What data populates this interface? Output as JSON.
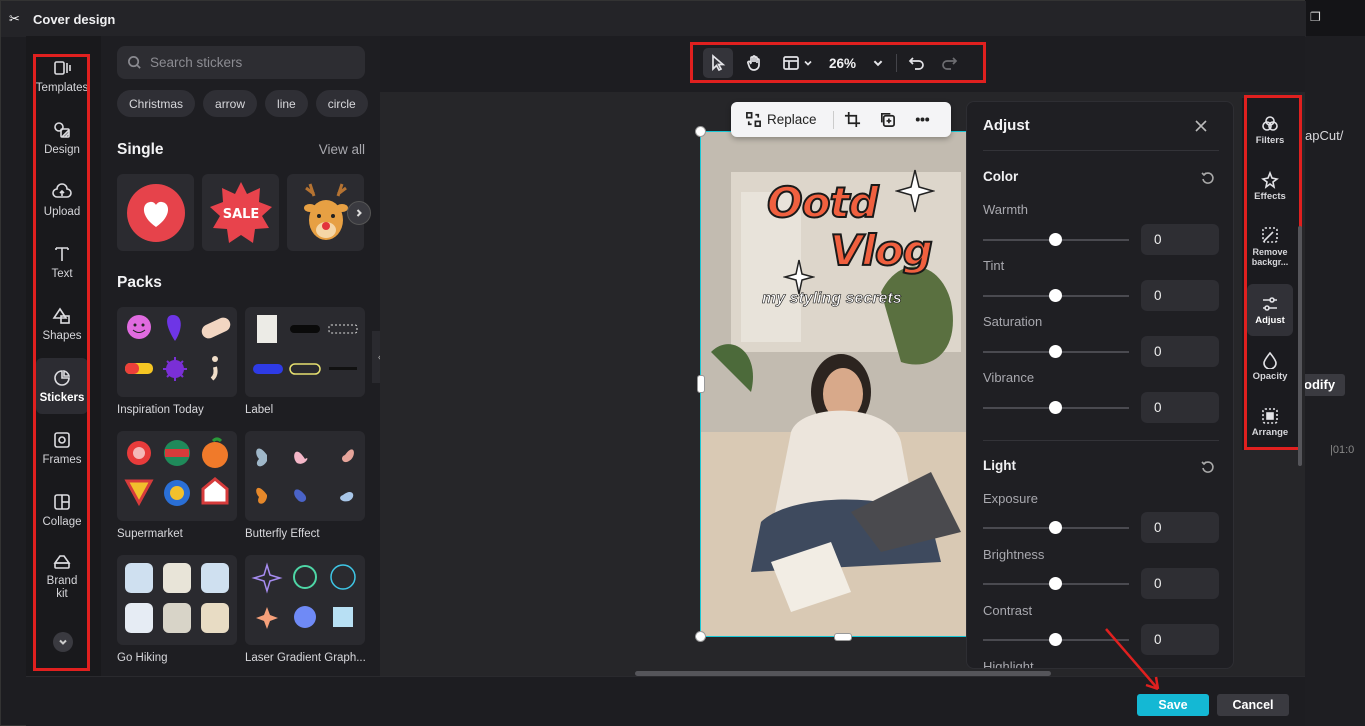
{
  "window": {
    "title": "Cover design"
  },
  "background_app": {
    "path_fragment": "apCut/",
    "modify_label": "odify",
    "time_label": "|01:0"
  },
  "nav": {
    "items": [
      {
        "label": "Templates"
      },
      {
        "label": "Design"
      },
      {
        "label": "Upload"
      },
      {
        "label": "Text"
      },
      {
        "label": "Shapes"
      },
      {
        "label": "Stickers",
        "active": true
      },
      {
        "label": "Frames"
      },
      {
        "label": "Collage"
      },
      {
        "label": "Brand kit"
      }
    ]
  },
  "stickers": {
    "search_placeholder": "Search stickers",
    "chips": [
      "Christmas",
      "arrow",
      "line",
      "circle"
    ],
    "single_title": "Single",
    "view_all": "View all",
    "single_items": [
      {
        "icon": "heart-sticker"
      },
      {
        "icon": "sale-sticker",
        "text": "SALE"
      },
      {
        "icon": "reindeer-sticker"
      }
    ],
    "packs_title": "Packs",
    "packs": [
      {
        "name": "Inspiration Today"
      },
      {
        "name": "Label"
      },
      {
        "name": "Supermarket"
      },
      {
        "name": "Butterfly Effect"
      },
      {
        "name": "Go Hiking"
      },
      {
        "name": "Laser Gradient Graph..."
      }
    ]
  },
  "toolbar": {
    "zoom": "26%"
  },
  "image_toolbar": {
    "replace_label": "Replace"
  },
  "cover_text": {
    "line1": "Ootd",
    "line2": "Vlog",
    "subtitle": "my styling secrets"
  },
  "adjust": {
    "title": "Adjust",
    "color_section": "Color",
    "color_rows": [
      {
        "label": "Warmth",
        "value": "0"
      },
      {
        "label": "Tint",
        "value": "0"
      },
      {
        "label": "Saturation",
        "value": "0"
      },
      {
        "label": "Vibrance",
        "value": "0"
      }
    ],
    "light_section": "Light",
    "light_rows": [
      {
        "label": "Exposure",
        "value": "0"
      },
      {
        "label": "Brightness",
        "value": "0"
      },
      {
        "label": "Contrast",
        "value": "0"
      },
      {
        "label": "Highlight",
        "value": ""
      }
    ]
  },
  "right_tools": [
    {
      "label": "Filters"
    },
    {
      "label": "Effects"
    },
    {
      "label": "Remove backgr..."
    },
    {
      "label": "Adjust",
      "active": true
    },
    {
      "label": "Opacity"
    },
    {
      "label": "Arrange"
    }
  ],
  "footer": {
    "save_label": "Save",
    "cancel_label": "Cancel"
  },
  "colors": {
    "accent": "#14b8d4",
    "annotation": "#e0201f",
    "selection": "#18c7d6"
  }
}
